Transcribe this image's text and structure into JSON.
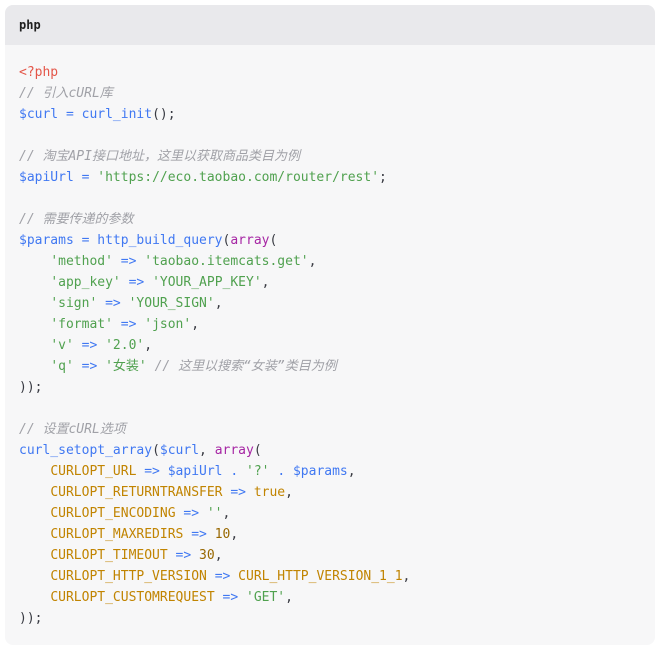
{
  "code_block": {
    "language": "php",
    "lines": [
      [
        {
          "t": "tag",
          "v": "<?php"
        }
      ],
      [
        {
          "t": "comment",
          "v": "// 引入cURL库"
        }
      ],
      [
        {
          "t": "var",
          "v": "$curl"
        },
        {
          "t": "plain",
          "v": " "
        },
        {
          "t": "op",
          "v": "="
        },
        {
          "t": "plain",
          "v": " "
        },
        {
          "t": "fn",
          "v": "curl_init"
        },
        {
          "t": "plain",
          "v": "();"
        }
      ],
      [],
      [
        {
          "t": "comment",
          "v": "// 淘宝API接口地址，这里以获取商品类目为例"
        }
      ],
      [
        {
          "t": "var",
          "v": "$apiUrl"
        },
        {
          "t": "plain",
          "v": " "
        },
        {
          "t": "op",
          "v": "="
        },
        {
          "t": "plain",
          "v": " "
        },
        {
          "t": "str",
          "v": "'https://eco.taobao.com/router/rest'"
        },
        {
          "t": "plain",
          "v": ";"
        }
      ],
      [],
      [
        {
          "t": "comment",
          "v": "// 需要传递的参数"
        }
      ],
      [
        {
          "t": "var",
          "v": "$params"
        },
        {
          "t": "plain",
          "v": " "
        },
        {
          "t": "op",
          "v": "="
        },
        {
          "t": "plain",
          "v": " "
        },
        {
          "t": "fn",
          "v": "http_build_query"
        },
        {
          "t": "plain",
          "v": "("
        },
        {
          "t": "kw",
          "v": "array"
        },
        {
          "t": "plain",
          "v": "("
        }
      ],
      [
        {
          "t": "plain",
          "v": "    "
        },
        {
          "t": "str",
          "v": "'method'"
        },
        {
          "t": "plain",
          "v": " "
        },
        {
          "t": "op",
          "v": "=>"
        },
        {
          "t": "plain",
          "v": " "
        },
        {
          "t": "str",
          "v": "'taobao.itemcats.get'"
        },
        {
          "t": "plain",
          "v": ","
        }
      ],
      [
        {
          "t": "plain",
          "v": "    "
        },
        {
          "t": "str",
          "v": "'app_key'"
        },
        {
          "t": "plain",
          "v": " "
        },
        {
          "t": "op",
          "v": "=>"
        },
        {
          "t": "plain",
          "v": " "
        },
        {
          "t": "str",
          "v": "'YOUR_APP_KEY'"
        },
        {
          "t": "plain",
          "v": ","
        }
      ],
      [
        {
          "t": "plain",
          "v": "    "
        },
        {
          "t": "str",
          "v": "'sign'"
        },
        {
          "t": "plain",
          "v": " "
        },
        {
          "t": "op",
          "v": "=>"
        },
        {
          "t": "plain",
          "v": " "
        },
        {
          "t": "str",
          "v": "'YOUR_SIGN'"
        },
        {
          "t": "plain",
          "v": ","
        }
      ],
      [
        {
          "t": "plain",
          "v": "    "
        },
        {
          "t": "str",
          "v": "'format'"
        },
        {
          "t": "plain",
          "v": " "
        },
        {
          "t": "op",
          "v": "=>"
        },
        {
          "t": "plain",
          "v": " "
        },
        {
          "t": "str",
          "v": "'json'"
        },
        {
          "t": "plain",
          "v": ","
        }
      ],
      [
        {
          "t": "plain",
          "v": "    "
        },
        {
          "t": "str",
          "v": "'v'"
        },
        {
          "t": "plain",
          "v": " "
        },
        {
          "t": "op",
          "v": "=>"
        },
        {
          "t": "plain",
          "v": " "
        },
        {
          "t": "str",
          "v": "'2.0'"
        },
        {
          "t": "plain",
          "v": ","
        }
      ],
      [
        {
          "t": "plain",
          "v": "    "
        },
        {
          "t": "str",
          "v": "'q'"
        },
        {
          "t": "plain",
          "v": " "
        },
        {
          "t": "op",
          "v": "=>"
        },
        {
          "t": "plain",
          "v": " "
        },
        {
          "t": "str",
          "v": "'女装'"
        },
        {
          "t": "plain",
          "v": " "
        },
        {
          "t": "comment",
          "v": "// 这里以搜索“女装”类目为例"
        }
      ],
      [
        {
          "t": "plain",
          "v": "));"
        }
      ],
      [],
      [
        {
          "t": "comment",
          "v": "// 设置cURL选项"
        }
      ],
      [
        {
          "t": "fn",
          "v": "curl_setopt_array"
        },
        {
          "t": "plain",
          "v": "("
        },
        {
          "t": "var",
          "v": "$curl"
        },
        {
          "t": "plain",
          "v": ", "
        },
        {
          "t": "kw",
          "v": "array"
        },
        {
          "t": "plain",
          "v": "("
        }
      ],
      [
        {
          "t": "plain",
          "v": "    "
        },
        {
          "t": "const",
          "v": "CURLOPT_URL"
        },
        {
          "t": "plain",
          "v": " "
        },
        {
          "t": "op",
          "v": "=>"
        },
        {
          "t": "plain",
          "v": " "
        },
        {
          "t": "var",
          "v": "$apiUrl"
        },
        {
          "t": "plain",
          "v": " "
        },
        {
          "t": "op",
          "v": "."
        },
        {
          "t": "plain",
          "v": " "
        },
        {
          "t": "str",
          "v": "'?'"
        },
        {
          "t": "plain",
          "v": " "
        },
        {
          "t": "op",
          "v": "."
        },
        {
          "t": "plain",
          "v": " "
        },
        {
          "t": "var",
          "v": "$params"
        },
        {
          "t": "plain",
          "v": ","
        }
      ],
      [
        {
          "t": "plain",
          "v": "    "
        },
        {
          "t": "const",
          "v": "CURLOPT_RETURNTRANSFER"
        },
        {
          "t": "plain",
          "v": " "
        },
        {
          "t": "op",
          "v": "=>"
        },
        {
          "t": "plain",
          "v": " "
        },
        {
          "t": "const",
          "v": "true"
        },
        {
          "t": "plain",
          "v": ","
        }
      ],
      [
        {
          "t": "plain",
          "v": "    "
        },
        {
          "t": "const",
          "v": "CURLOPT_ENCODING"
        },
        {
          "t": "plain",
          "v": " "
        },
        {
          "t": "op",
          "v": "=>"
        },
        {
          "t": "plain",
          "v": " "
        },
        {
          "t": "str",
          "v": "''"
        },
        {
          "t": "plain",
          "v": ","
        }
      ],
      [
        {
          "t": "plain",
          "v": "    "
        },
        {
          "t": "const",
          "v": "CURLOPT_MAXREDIRS"
        },
        {
          "t": "plain",
          "v": " "
        },
        {
          "t": "op",
          "v": "=>"
        },
        {
          "t": "plain",
          "v": " "
        },
        {
          "t": "num",
          "v": "10"
        },
        {
          "t": "plain",
          "v": ","
        }
      ],
      [
        {
          "t": "plain",
          "v": "    "
        },
        {
          "t": "const",
          "v": "CURLOPT_TIMEOUT"
        },
        {
          "t": "plain",
          "v": " "
        },
        {
          "t": "op",
          "v": "=>"
        },
        {
          "t": "plain",
          "v": " "
        },
        {
          "t": "num",
          "v": "30"
        },
        {
          "t": "plain",
          "v": ","
        }
      ],
      [
        {
          "t": "plain",
          "v": "    "
        },
        {
          "t": "const",
          "v": "CURLOPT_HTTP_VERSION"
        },
        {
          "t": "plain",
          "v": " "
        },
        {
          "t": "op",
          "v": "=>"
        },
        {
          "t": "plain",
          "v": " "
        },
        {
          "t": "const",
          "v": "CURL_HTTP_VERSION_1_1"
        },
        {
          "t": "plain",
          "v": ","
        }
      ],
      [
        {
          "t": "plain",
          "v": "    "
        },
        {
          "t": "const",
          "v": "CURLOPT_CUSTOMREQUEST"
        },
        {
          "t": "plain",
          "v": " "
        },
        {
          "t": "op",
          "v": "=>"
        },
        {
          "t": "plain",
          "v": " "
        },
        {
          "t": "str",
          "v": "'GET'"
        },
        {
          "t": "plain",
          "v": ","
        }
      ],
      [
        {
          "t": "plain",
          "v": "));"
        }
      ]
    ]
  },
  "colors": {
    "card_background": "#f7f7f8",
    "header_background": "#e9e9ec",
    "tag": "#e45649",
    "comment": "#a0a1a7",
    "variable": "#4078f2",
    "keyword": "#a626a4",
    "string": "#50a14f",
    "constant": "#c18401",
    "number": "#986801"
  }
}
